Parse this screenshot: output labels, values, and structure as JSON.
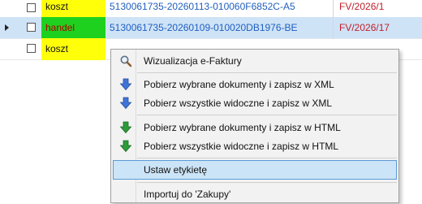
{
  "grid": {
    "rows": [
      {
        "type": "koszt",
        "ident": "5130061735-20260113-010060F6852C-A5",
        "doc": "FV/2026/1",
        "selected": false
      },
      {
        "type": "handel",
        "ident": "5130061735-20260109-010020DB1976-BE",
        "doc": "FV/2026/17",
        "selected": true
      },
      {
        "type": "koszt",
        "ident": "",
        "doc": "",
        "selected": false
      }
    ]
  },
  "context_menu": {
    "items": [
      {
        "label": "Wizualizacja e-Faktury",
        "icon": "magnifier-icon"
      },
      {
        "label": "Pobierz wybrane dokumenty i zapisz w XML",
        "icon": "blue-download-arrow-icon"
      },
      {
        "label": "Pobierz wszystkie widoczne i zapisz w XML",
        "icon": "blue-download-arrow-icon"
      },
      {
        "label": "Pobierz wybrane dokumenty i zapisz w HTML",
        "icon": "green-download-arrow-icon"
      },
      {
        "label": "Pobierz wszystkie widoczne i zapisz w HTML",
        "icon": "green-download-arrow-icon"
      },
      {
        "label": "Ustaw etykietę",
        "icon": "",
        "highlighted": true
      },
      {
        "label": "Importuj do 'Zakupy'",
        "icon": ""
      }
    ]
  },
  "colors": {
    "koszt_bg": "#ffff0a",
    "handel_bg": "#1fd11f",
    "handel_text": "#b00000",
    "ident_text": "#1f5fbf",
    "doc_text": "#c0202a",
    "selected_row": "#cfe3f7",
    "menu_highlight": "#cce4f7"
  }
}
